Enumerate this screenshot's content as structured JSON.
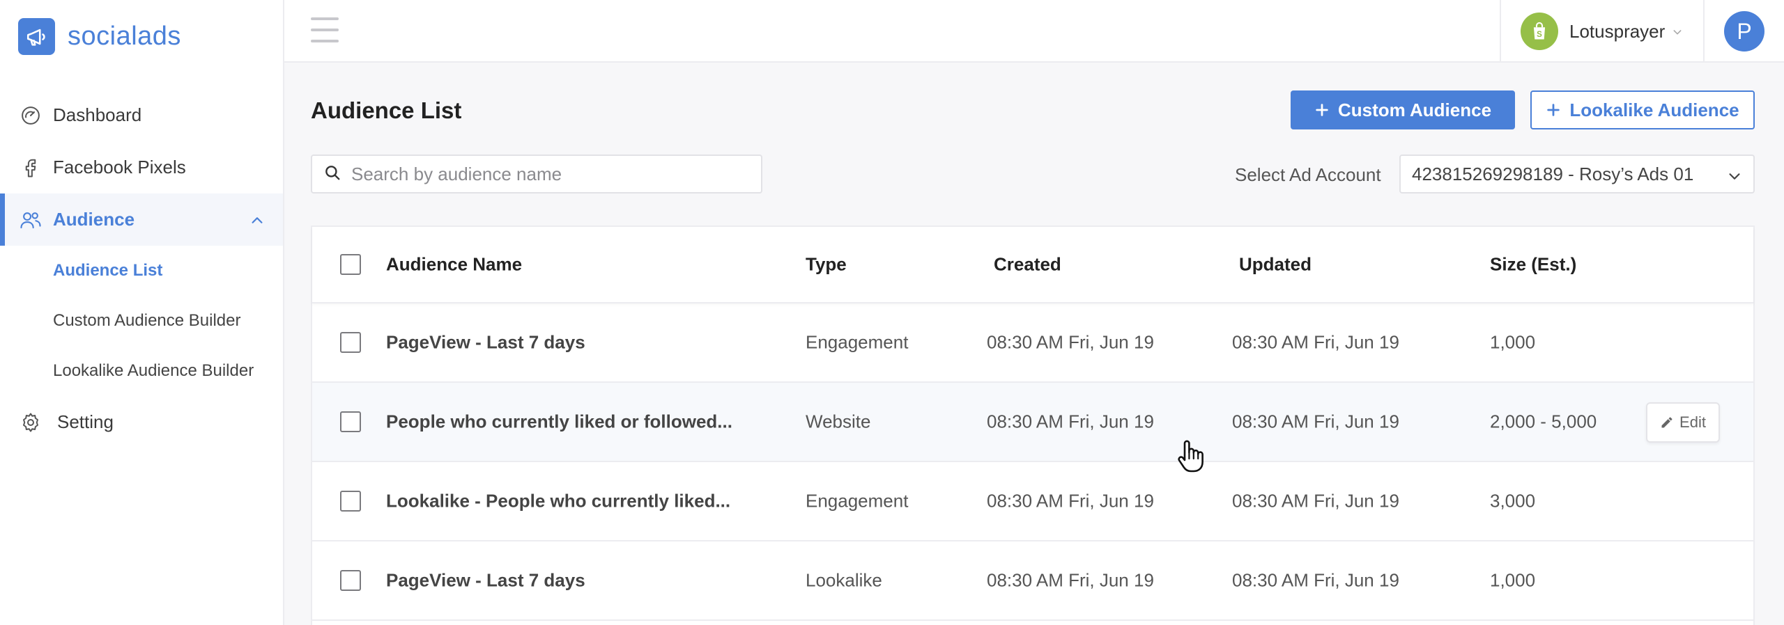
{
  "brand": {
    "name": "socialads",
    "icon": "megaphone-icon",
    "color": "#4a80d8"
  },
  "sidebar": {
    "items": [
      {
        "label": "Dashboard",
        "icon": "dashboard-gauge-icon"
      },
      {
        "label": "Facebook Pixels",
        "icon": "facebook-icon"
      },
      {
        "label": "Audience",
        "icon": "users-icon",
        "active": true,
        "expanded": true
      },
      {
        "label": "Setting",
        "icon": "gear-icon"
      }
    ],
    "subitems": [
      {
        "label": "Audience List",
        "active": true
      },
      {
        "label": "Custom Audience Builder"
      },
      {
        "label": "Lookalike Audience Builder"
      }
    ]
  },
  "topbar": {
    "store_name": "Lotusprayer",
    "store_icon": "shopify-bag-icon",
    "avatar_initial": "P"
  },
  "page": {
    "title": "Audience List",
    "custom_audience_button": "Custom Audience",
    "lookalike_audience_button": "Lookalike Audience",
    "search_placeholder": "Search by audience name",
    "select_account_label": "Select Ad Account",
    "selected_account": "423815269298189 - Rosy’s Ads 01"
  },
  "table": {
    "headers": {
      "name": "Audience Name",
      "type": "Type",
      "created": "Created",
      "updated": "Updated",
      "size": "Size (Est.)"
    },
    "rows": [
      {
        "name": "PageView - Last 7 days",
        "type": "Engagement",
        "created": "08:30 AM Fri, Jun  19",
        "updated": "08:30 AM Fri, Jun  19",
        "size": "1,000"
      },
      {
        "name": "People who currently liked or followed...",
        "type": "Website",
        "created": "08:30 AM Fri, Jun  19",
        "updated": "08:30 AM Fri, Jun  19",
        "size": "2,000 - 5,000"
      },
      {
        "name": "Lookalike - People who currently liked...",
        "type": "Engagement",
        "created": "08:30 AM Fri, Jun  19",
        "updated": "08:30 AM Fri, Jun  19",
        "size": "3,000"
      },
      {
        "name": "PageView - Last 7 days",
        "type": "Lookalike",
        "created": "08:30 AM Fri, Jun  19",
        "updated": "08:30 AM Fri, Jun  19",
        "size": "1,000"
      }
    ],
    "edit_label": "Edit"
  }
}
